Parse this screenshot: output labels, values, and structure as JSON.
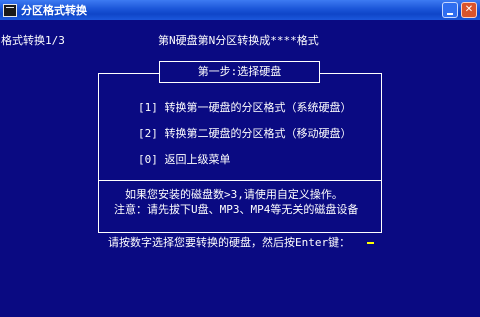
{
  "window": {
    "title": "分区格式转换"
  },
  "header": {
    "left_status": "格式转换1/3",
    "center_title": "第N硬盘第N分区转换成****格式"
  },
  "dialog": {
    "step_title": "第一步:选择硬盘",
    "options": [
      "[1] 转换第一硬盘的分区格式（系统硬盘）",
      "[2] 转换第二硬盘的分区格式（移动硬盘）",
      "[0] 返回上级菜单"
    ],
    "note_line1": "如果您安装的磁盘数>3,请使用自定义操作。",
    "note_line2": "注意：请先拔下U盘、MP3、MP4等无关的磁盘设备"
  },
  "prompt": {
    "text": "请按数字选择您要转换的硬盘，然后按Enter键："
  },
  "colors": {
    "background": "#0a0a82",
    "text": "#ffffff",
    "cursor": "#ffff00"
  }
}
